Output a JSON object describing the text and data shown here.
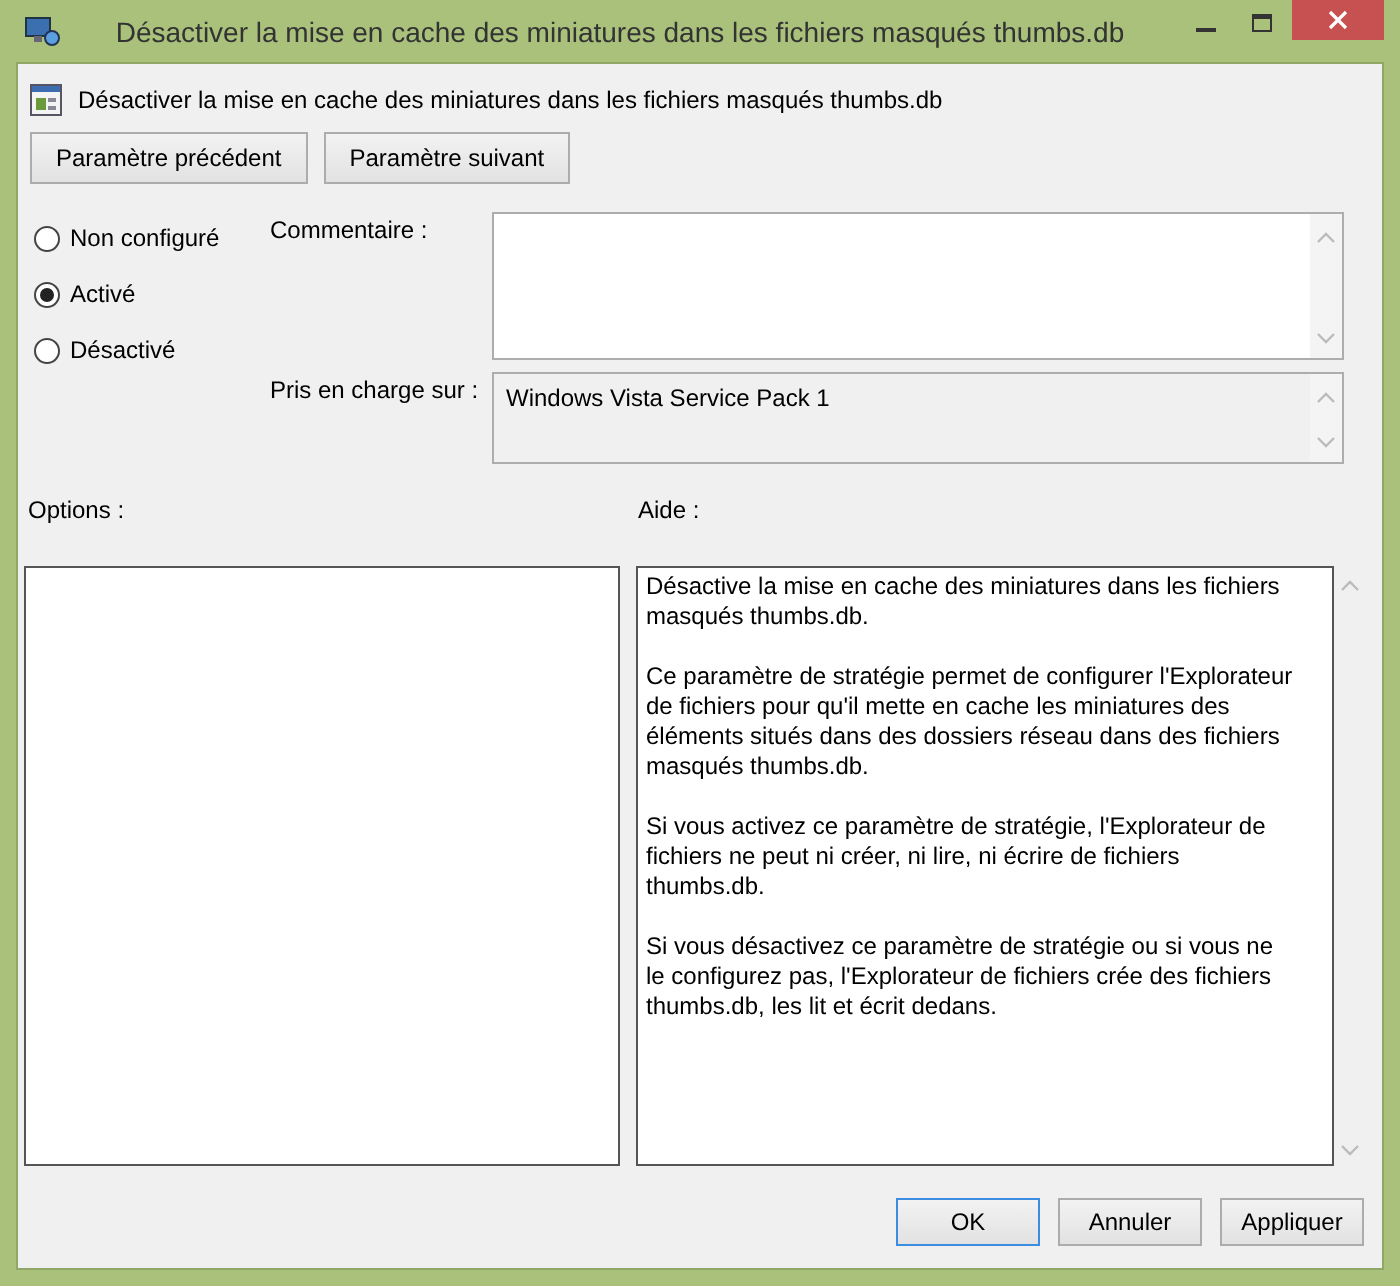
{
  "window": {
    "title": "Désactiver la mise en cache des miniatures dans les fichiers masqués thumbs.db"
  },
  "header": {
    "title": "Désactiver la mise en cache des miniatures dans les fichiers masqués thumbs.db"
  },
  "nav_buttons": [
    "Paramètre précédent",
    "Paramètre suivant"
  ],
  "state_options": [
    {
      "label": "Non configuré",
      "selected": false
    },
    {
      "label": "Activé",
      "selected": true
    },
    {
      "label": "Désactivé",
      "selected": false
    }
  ],
  "comment": {
    "label": "Commentaire :"
  },
  "supported_on": {
    "label": "Pris en charge sur :",
    "value": "Windows Vista Service Pack 1"
  },
  "options": {
    "label": "Options :"
  },
  "help": {
    "label": "Aide :",
    "paragraphs": [
      "Désactive la mise en cache des miniatures dans les fichiers masqués thumbs.db.",
      "Ce paramètre de stratégie permet de configurer l'Explorateur de fichiers pour qu'il mette en cache les miniatures des éléments situés dans des dossiers réseau dans des fichiers masqués thumbs.db.",
      "Si vous activez ce paramètre de stratégie, l'Explorateur de fichiers ne peut ni créer, ni lire, ni écrire de fichiers thumbs.db.",
      "Si vous désactivez ce paramètre de stratégie ou si vous ne le configurez pas, l'Explorateur de fichiers crée des fichiers thumbs.db, les lit et écrit dedans."
    ]
  },
  "buttons": [
    {
      "label": "OK",
      "default": true
    },
    {
      "label": "Annuler",
      "default": false
    },
    {
      "label": "Appliquer",
      "default": false
    }
  ]
}
